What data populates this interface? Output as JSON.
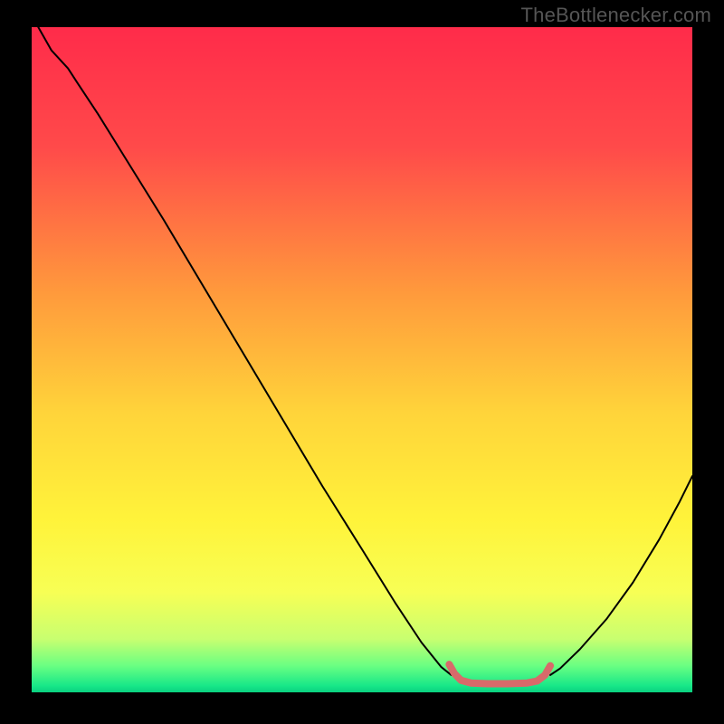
{
  "watermark": "TheBottlenecker.com",
  "chart_data": {
    "type": "line",
    "title": "",
    "xlabel": "",
    "ylabel": "",
    "xlim": [
      0,
      100
    ],
    "ylim": [
      0,
      100
    ],
    "gradient_stops": [
      {
        "offset": 0,
        "color": "#ff2b4a"
      },
      {
        "offset": 18,
        "color": "#ff4a4a"
      },
      {
        "offset": 40,
        "color": "#ff9a3c"
      },
      {
        "offset": 58,
        "color": "#ffd43a"
      },
      {
        "offset": 74,
        "color": "#fff33a"
      },
      {
        "offset": 85,
        "color": "#f7ff55"
      },
      {
        "offset": 92,
        "color": "#c8ff70"
      },
      {
        "offset": 96,
        "color": "#6aff82"
      },
      {
        "offset": 99,
        "color": "#18e888"
      },
      {
        "offset": 100,
        "color": "#0ad080"
      }
    ],
    "series": [
      {
        "name": "bottleneck-curve-left",
        "stroke": "#000000",
        "width": 2,
        "points": [
          {
            "x": 1.0,
            "y": 100.0
          },
          {
            "x": 3.0,
            "y": 96.5
          },
          {
            "x": 5.5,
            "y": 93.8
          },
          {
            "x": 7.0,
            "y": 91.5
          },
          {
            "x": 10.0,
            "y": 87.0
          },
          {
            "x": 15.0,
            "y": 79.0
          },
          {
            "x": 20.0,
            "y": 71.0
          },
          {
            "x": 26.0,
            "y": 61.0
          },
          {
            "x": 32.0,
            "y": 51.0
          },
          {
            "x": 38.0,
            "y": 41.0
          },
          {
            "x": 44.0,
            "y": 31.0
          },
          {
            "x": 50.0,
            "y": 21.5
          },
          {
            "x": 55.0,
            "y": 13.5
          },
          {
            "x": 59.0,
            "y": 7.5
          },
          {
            "x": 62.0,
            "y": 3.8
          },
          {
            "x": 63.5,
            "y": 2.6
          }
        ]
      },
      {
        "name": "bottleneck-curve-right",
        "stroke": "#000000",
        "width": 2,
        "points": [
          {
            "x": 78.5,
            "y": 2.6
          },
          {
            "x": 80.0,
            "y": 3.6
          },
          {
            "x": 83.0,
            "y": 6.5
          },
          {
            "x": 87.0,
            "y": 11.0
          },
          {
            "x": 91.0,
            "y": 16.5
          },
          {
            "x": 95.0,
            "y": 23.0
          },
          {
            "x": 98.0,
            "y": 28.5
          },
          {
            "x": 100.0,
            "y": 32.5
          }
        ]
      },
      {
        "name": "optimum-band",
        "stroke": "#d86a6a",
        "width": 8,
        "points": [
          {
            "x": 63.2,
            "y": 4.2
          },
          {
            "x": 64.0,
            "y": 2.8
          },
          {
            "x": 65.0,
            "y": 1.8
          },
          {
            "x": 66.5,
            "y": 1.4
          },
          {
            "x": 69.0,
            "y": 1.3
          },
          {
            "x": 72.0,
            "y": 1.3
          },
          {
            "x": 75.0,
            "y": 1.4
          },
          {
            "x": 76.5,
            "y": 1.7
          },
          {
            "x": 77.7,
            "y": 2.6
          },
          {
            "x": 78.5,
            "y": 4.0
          }
        ]
      }
    ]
  }
}
